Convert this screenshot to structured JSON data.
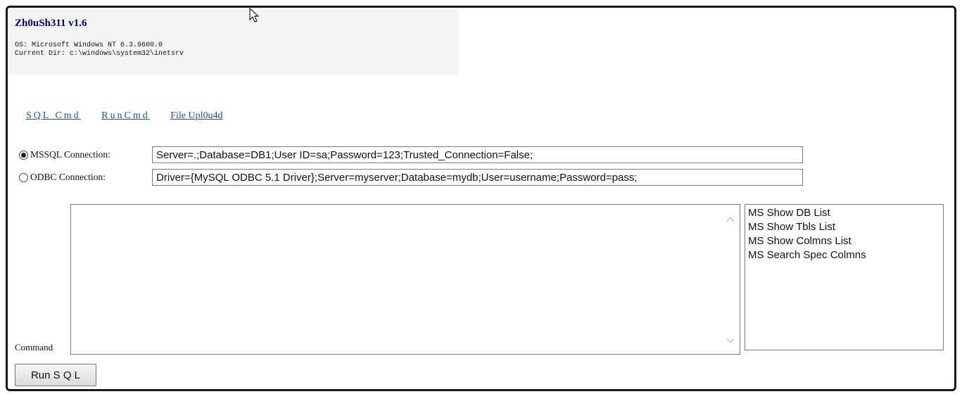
{
  "header": {
    "title": "Zh0uSh311 v1.6",
    "os_line": "OS: Microsoft Windows NT 6.3.9600.0",
    "dir_line": "Current Dir: c:\\windows\\system32\\inetsrv"
  },
  "nav": {
    "sql_cmd": "SQL Cmd",
    "run_cmd": "RunCmd",
    "file_upload": "File Upl0u4d"
  },
  "connections": {
    "mssql": {
      "label": "MSSQL Connection:",
      "value": "Server=.;Database=DB1;User ID=sa;Password=123;Trusted_Connection=False;",
      "checked": true
    },
    "odbc": {
      "label": "ODBC Connection:",
      "value": "Driver={MySQL ODBC 5.1 Driver};Server=myserver;Database=mydb;User=username;Password=pass;",
      "checked": false
    }
  },
  "command": {
    "label": "Command",
    "value": ""
  },
  "query_list": {
    "items": [
      "MS Show DB List",
      "MS Show Tbls List",
      "MS Show Colmns List",
      "MS Search Spec Colmns"
    ]
  },
  "run_button": {
    "label": "Run S Q L"
  },
  "icons": {
    "cursor": "mouse-pointer-icon",
    "scroll_up": "chevron-up-icon",
    "scroll_down": "chevron-down-icon",
    "radio": "radio-icon"
  }
}
